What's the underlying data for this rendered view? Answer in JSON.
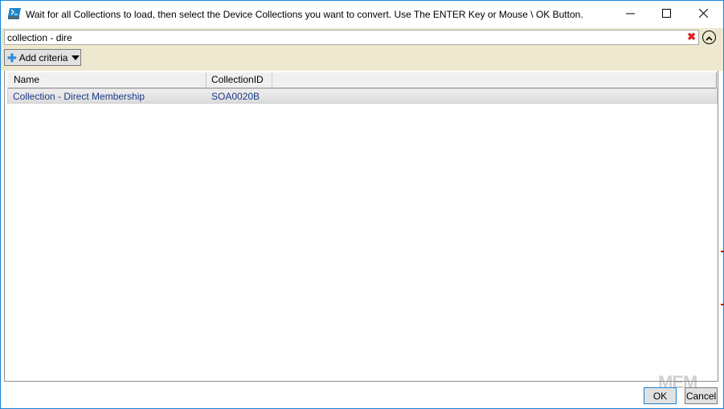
{
  "window": {
    "title": "Wait for all Collections to load, then select the Device Collections you want to convert. Use The ENTER Key or Mouse \\ OK Button.",
    "icon": "powershell-icon",
    "controls": [
      "minimize-icon",
      "maximize-icon",
      "close-icon"
    ]
  },
  "filter": {
    "search_value": "collection - dire",
    "clear_icon": "✖",
    "collapse_icon": "chevron-up-icon",
    "add_criteria_label": "Add criteria"
  },
  "grid": {
    "columns": [
      "Name",
      "CollectionID"
    ],
    "rows": [
      {
        "name": "Collection - Direct Membership",
        "collection_id": "SOA0020B"
      }
    ]
  },
  "buttons": {
    "ok_label": "OK",
    "cancel_label": "Cancel"
  },
  "watermark": "MEM",
  "colors": {
    "accent": "#1883d7",
    "filter_bg": "#eee8d0",
    "row_text": "#1c3b8a",
    "clear_red": "#e02020"
  }
}
